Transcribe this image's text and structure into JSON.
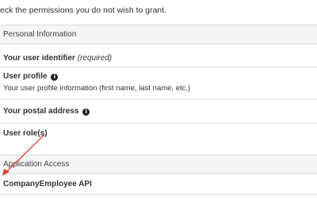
{
  "intro_text": "eck the permissions you do not wish to grant.",
  "sections": {
    "personal_info": {
      "header": "Personal Information",
      "items": {
        "user_identifier": {
          "title": "Your user identifier",
          "note": "(required)"
        },
        "user_profile": {
          "title": "User profile",
          "description": "Your user profile information (first name, last name, etc.)",
          "icon": "info-icon"
        },
        "postal_address": {
          "title": "Your postal address",
          "icon": "info-icon"
        },
        "user_roles": {
          "title": "User role(s)"
        }
      }
    },
    "application_access": {
      "header": "Application Access",
      "items": {
        "company_employee_api": {
          "title": "CompanyEmployee API"
        }
      }
    }
  },
  "annotation": {
    "arrow_color": "#e0443a"
  }
}
